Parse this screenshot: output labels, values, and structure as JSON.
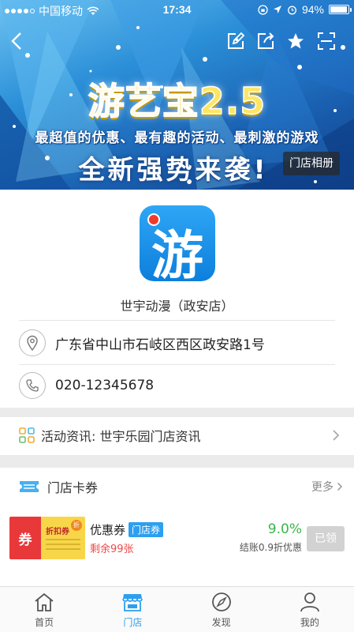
{
  "status_bar": {
    "carrier": "中国移动",
    "time": "17:34",
    "battery_pct": "94%",
    "battery_level": 0.94
  },
  "banner": {
    "title": "游艺宝2.5",
    "subtitle": "最超值的优惠、最有趣的活动、最刺激的游戏",
    "headline": "全新强势来袭!",
    "album_button": "门店相册"
  },
  "toolbar": {
    "icons": [
      "back-icon",
      "edit-icon",
      "share-icon",
      "star-icon",
      "scan-icon"
    ]
  },
  "store": {
    "logo_glyph": "游",
    "name": "世宇动漫（政安店）",
    "address": "广东省中山市石岐区西区政安路1号",
    "phone": "020-12345678"
  },
  "activity": {
    "label": "活动资讯: 世宇乐园门店资讯"
  },
  "cards_section": {
    "title": "门店卡券",
    "more": "更多"
  },
  "coupon": {
    "image_text_left": "券",
    "image_text_tag": "折扣券",
    "image_text_badge": "折",
    "name": "优惠券",
    "badge": "门店券",
    "remaining": "剩余99张",
    "rate": "9.0%",
    "note": "结账0.9折优惠",
    "button": "已领"
  },
  "tabs": [
    {
      "label": "首页",
      "icon": "home-icon",
      "active": false
    },
    {
      "label": "门店",
      "icon": "store-icon",
      "active": true
    },
    {
      "label": "发现",
      "icon": "compass-icon",
      "active": false
    },
    {
      "label": "我的",
      "icon": "user-icon",
      "active": false
    }
  ],
  "colors": {
    "accent": "#2e9ff0",
    "coupon_rate": "#39b54a",
    "coupon_remaining": "#f04848"
  }
}
